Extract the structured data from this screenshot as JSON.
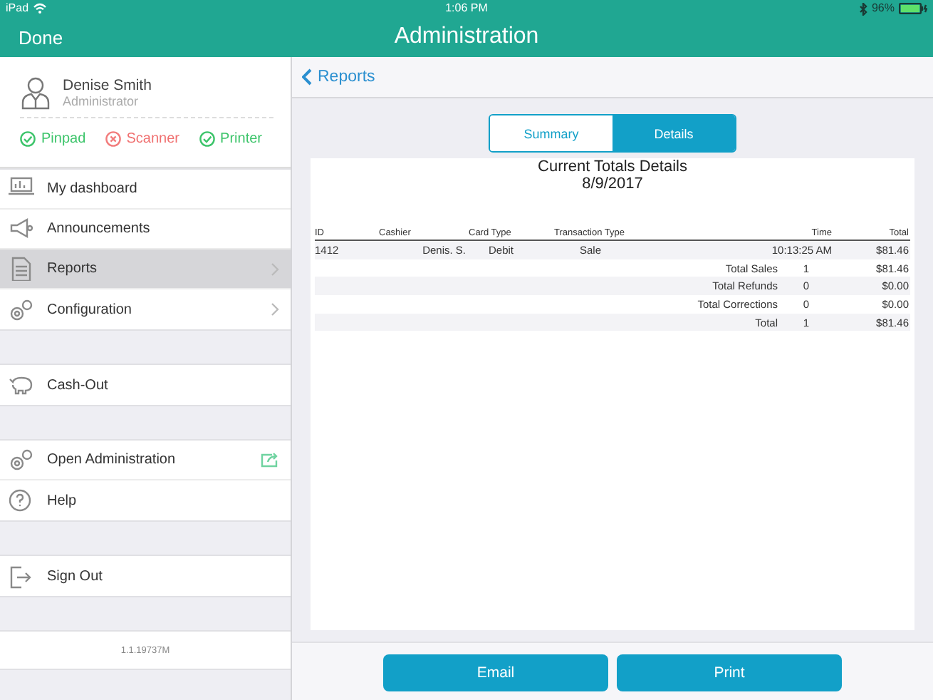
{
  "status_bar": {
    "device": "iPad",
    "time": "1:06 PM",
    "battery": "96%"
  },
  "header": {
    "done": "Done",
    "title": "Administration"
  },
  "profile": {
    "name": "Denise Smith",
    "role": "Administrator"
  },
  "devices": [
    {
      "label": "Pinpad",
      "ok": true
    },
    {
      "label": "Scanner",
      "ok": false
    },
    {
      "label": "Printer",
      "ok": true
    }
  ],
  "menu_groups": [
    [
      {
        "label": "My dashboard",
        "selected": false,
        "submenu": false
      },
      {
        "label": "Announcements",
        "selected": false,
        "submenu": false
      },
      {
        "label": "Reports",
        "selected": true,
        "submenu": true
      },
      {
        "label": "Configuration",
        "selected": false,
        "submenu": true
      }
    ],
    [
      {
        "label": "Cash-Out",
        "selected": false,
        "submenu": false
      }
    ],
    [
      {
        "label": "Open Administration",
        "selected": false,
        "submenu": false,
        "external": true
      },
      {
        "label": "Help",
        "selected": false,
        "submenu": false
      }
    ],
    [
      {
        "label": "Sign Out",
        "selected": false,
        "submenu": false
      }
    ]
  ],
  "version": "1.1.19737M",
  "back": "Reports",
  "tabs": [
    {
      "label": "Summary",
      "selected": false
    },
    {
      "label": "Details",
      "selected": true
    }
  ],
  "report": {
    "title": "Current Totals Details",
    "date": "8/9/2017",
    "columns": [
      "ID",
      "Cashier",
      "Card Type",
      "Transaction Type",
      "Time",
      "Total"
    ],
    "rows": [
      [
        "1412",
        "Denis. S.",
        "Debit",
        "Sale",
        "10:13:25 AM",
        "$81.46"
      ]
    ],
    "summary": [
      {
        "label": "Total Sales",
        "count": "1",
        "total": "$81.46"
      },
      {
        "label": "Total Refunds",
        "count": "0",
        "total": "$0.00"
      },
      {
        "label": "Total Corrections",
        "count": "0",
        "total": "$0.00"
      },
      {
        "label": "Total",
        "count": "1",
        "total": "$81.46"
      }
    ]
  },
  "buttons": [
    "Email",
    "Print"
  ]
}
